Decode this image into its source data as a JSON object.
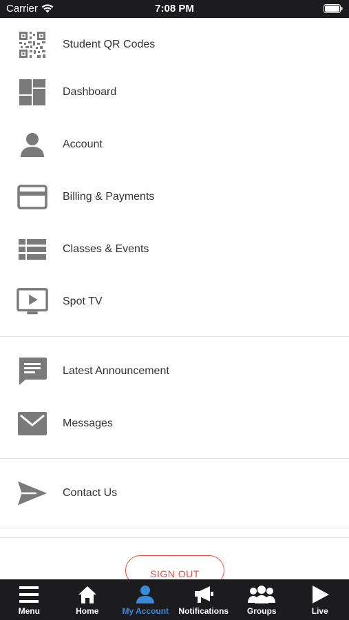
{
  "status_bar": {
    "carrier": "Carrier",
    "time": "7:08 PM"
  },
  "menu": {
    "items": [
      {
        "label": "Student QR Codes",
        "icon": "qr-code-icon"
      },
      {
        "label": "Dashboard",
        "icon": "dashboard-icon"
      },
      {
        "label": "Account",
        "icon": "person-icon"
      },
      {
        "label": "Billing & Payments",
        "icon": "credit-card-icon"
      },
      {
        "label": "Classes & Events",
        "icon": "list-icon"
      },
      {
        "label": "Spot TV",
        "icon": "tv-play-icon"
      },
      {
        "label": "Latest Announcement",
        "icon": "chat-bubble-icon"
      },
      {
        "label": "Messages",
        "icon": "envelope-icon"
      },
      {
        "label": "Contact Us",
        "icon": "send-icon"
      }
    ]
  },
  "signout_label": "SIGN OUT",
  "tabs": [
    {
      "label": "Menu",
      "icon": "hamburger-icon",
      "active": false
    },
    {
      "label": "Home",
      "icon": "home-icon",
      "active": false
    },
    {
      "label": "My Account",
      "icon": "person-icon",
      "active": true
    },
    {
      "label": "Notifications",
      "icon": "megaphone-icon",
      "active": false
    },
    {
      "label": "Groups",
      "icon": "group-icon",
      "active": false
    },
    {
      "label": "Live",
      "icon": "play-icon",
      "active": false
    }
  ],
  "colors": {
    "tab_bar": "#1c1c1e",
    "active_tab": "#3b8ad9",
    "icon_gray": "#8a8a8a",
    "signout_red": "#e74c3c"
  }
}
